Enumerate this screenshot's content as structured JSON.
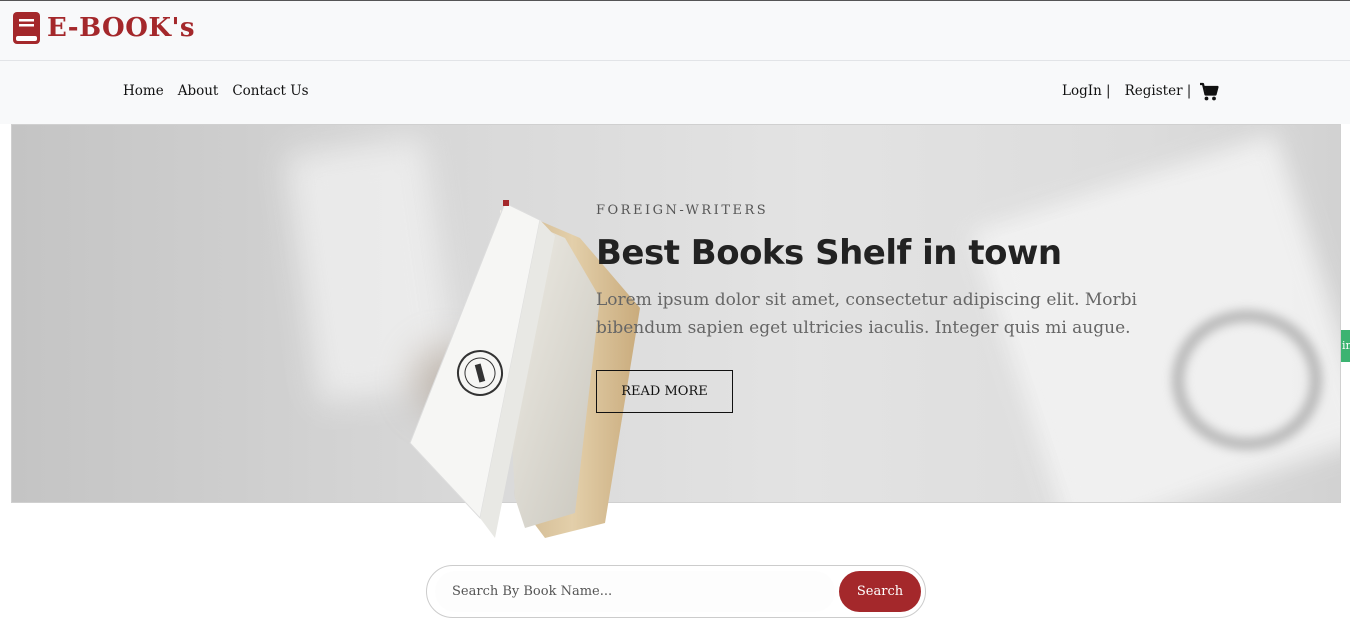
{
  "brand": {
    "title": "E-BOOK's",
    "icon": "book-icon",
    "color": "#a4282b"
  },
  "nav": {
    "left": [
      {
        "label": "Home"
      },
      {
        "label": "About"
      },
      {
        "label": "Contact Us"
      }
    ],
    "right": [
      {
        "label": "LogIn |"
      },
      {
        "label": "Register |"
      }
    ],
    "cart_icon": "cart-icon"
  },
  "hero": {
    "subtitle": "FOREIGN-WRITERS",
    "title": "Best Books Shelf in town",
    "text": "Lorem ipsum dolor sit amet, consectetur adipiscing elit. Morbi bibendum sapien eget ultricies iaculis. Integer quis mi augue.",
    "button_label": "READ MORE"
  },
  "side_tab": {
    "label": "in"
  },
  "search": {
    "placeholder": "Search By Book Name...",
    "button_label": "Search",
    "accent": "#a4282b"
  }
}
